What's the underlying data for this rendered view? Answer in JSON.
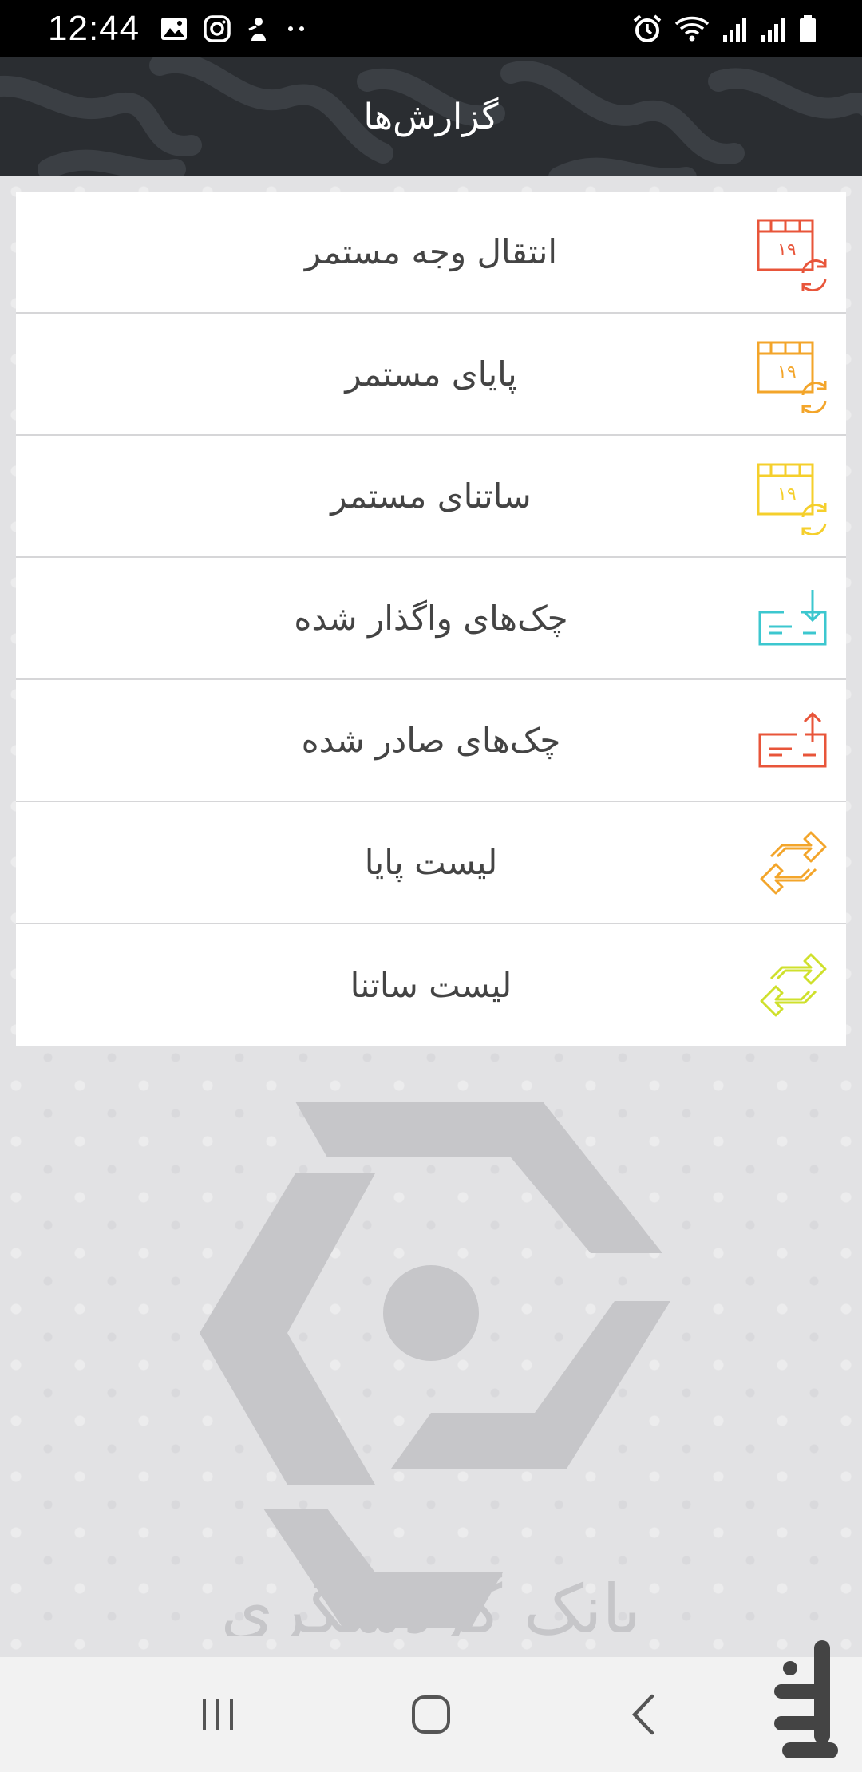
{
  "status_bar": {
    "time": "12:44"
  },
  "header": {
    "title": "گزارش‌ها"
  },
  "reports": [
    {
      "label": "انتقال وجه مستمر",
      "icon": "calendar-recurring-icon",
      "color": "#e8553a"
    },
    {
      "label": "پایای مستمر",
      "icon": "calendar-recurring-icon",
      "color": "#f3a52a"
    },
    {
      "label": "ساتنای مستمر",
      "icon": "calendar-recurring-icon",
      "color": "#f5cf2c"
    },
    {
      "label": "چک‌های واگذار شده",
      "icon": "cheque-received-icon",
      "color": "#3cc7cf"
    },
    {
      "label": "چک‌های صادر شده",
      "icon": "cheque-issued-icon",
      "color": "#e8553a"
    },
    {
      "label": "لیست پایا",
      "icon": "transfer-arrows-icon",
      "color": "#f3a52a"
    },
    {
      "label": "لیست ساتنا",
      "icon": "transfer-arrows-icon",
      "color": "#cfe02c"
    }
  ],
  "logo": {
    "text": "بانک گردشگری"
  },
  "watermark": {
    "text": "بازار"
  }
}
